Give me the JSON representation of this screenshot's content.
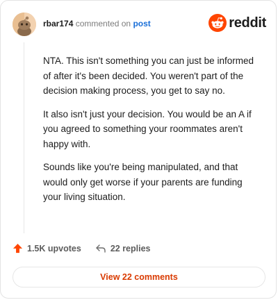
{
  "comment": {
    "username": "rbar174",
    "action_text": "commented on",
    "target_link": "post",
    "paragraphs": [
      "NTA. This isn't something you can just be informed of after it's been decided. You weren't part of the decision making process, you get to say no.",
      "It also isn't just your decision. You would be an A if you agreed to something your roommates aren't happy with.",
      "Sounds like you're being manipulated, and that would only get worse if your parents are funding your living situation."
    ]
  },
  "brand": {
    "wordmark": "reddit",
    "icon": "reddit-snoo-icon",
    "color": "#ff4500"
  },
  "footer": {
    "upvotes_label": "1.5K upvotes",
    "upvote_icon": "upvote-arrow-icon",
    "upvote_color": "#ff4500",
    "replies_label": "22 replies",
    "reply_icon": "reply-arrow-icon",
    "view_comments_label": "View 22 comments",
    "view_comments_color": "#d93a00"
  },
  "avatar": {
    "icon": "user-avatar",
    "bg_color": "#f0c9a0"
  }
}
